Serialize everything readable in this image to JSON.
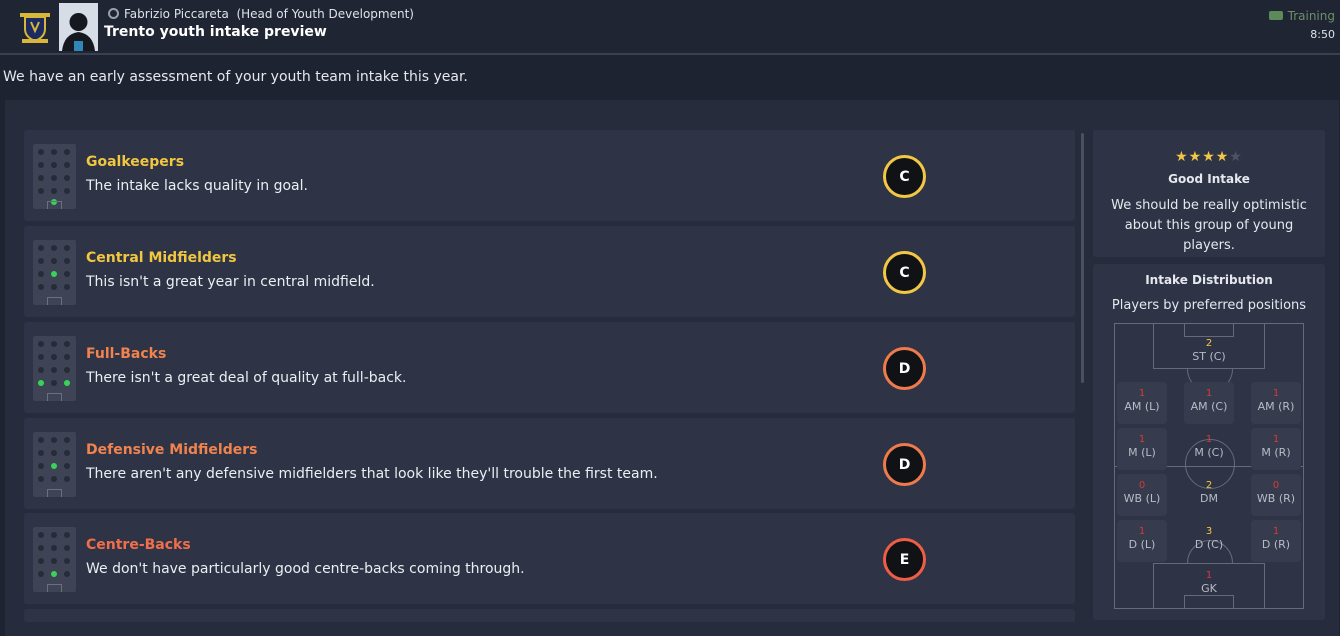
{
  "header": {
    "crest_icon": "club-crest-icon",
    "sender_icon": "person-icon",
    "sender": "Fabrizio Piccareta",
    "sender_role": "(Head of Youth Development)",
    "subject": "Trento youth intake preview",
    "status_icon": "ticket-icon",
    "status": "Training",
    "time": "8:50"
  },
  "intro": "We have an early assessment of your youth team intake this year.",
  "colors": {
    "grade_c": "#f3c744",
    "grade_d": "#ef7b4c",
    "grade_e": "#ef5d45",
    "positive_dot": "#38d45a"
  },
  "rows": [
    {
      "title": "Goalkeepers",
      "description": "The intake lacks quality in goal.",
      "grade": "C"
    },
    {
      "title": "Central Midfielders",
      "description": "This isn't a great year in central midfield.",
      "grade": "C"
    },
    {
      "title": "Full-Backs",
      "description": "There isn't a great deal of quality at full-back.",
      "grade": "D"
    },
    {
      "title": "Defensive Midfielders",
      "description": "There aren't any defensive midfielders that look like they'll trouble the first team.",
      "grade": "D"
    },
    {
      "title": "Centre-Backs",
      "description": "We don't have particularly good centre-backs coming through.",
      "grade": "E"
    }
  ],
  "rating": {
    "stars": 4,
    "max_stars": 5,
    "title": "Good Intake",
    "description": "We should be really optimistic about this group of young players."
  },
  "distribution": {
    "title": "Intake Distribution",
    "subtitle": "Players by preferred positions",
    "positions": {
      "st_c": {
        "label": "ST (C)",
        "count": "2"
      },
      "am_l": {
        "label": "AM (L)",
        "count": "1"
      },
      "am_c": {
        "label": "AM (C)",
        "count": "1"
      },
      "am_r": {
        "label": "AM (R)",
        "count": "1"
      },
      "m_l": {
        "label": "M (L)",
        "count": "1"
      },
      "m_c": {
        "label": "M (C)",
        "count": "1"
      },
      "m_r": {
        "label": "M (R)",
        "count": "1"
      },
      "wb_l": {
        "label": "WB (L)",
        "count": "0"
      },
      "dm": {
        "label": "DM",
        "count": "2"
      },
      "wb_r": {
        "label": "WB (R)",
        "count": "0"
      },
      "d_l": {
        "label": "D (L)",
        "count": "1"
      },
      "d_c": {
        "label": "D (C)",
        "count": "3"
      },
      "d_r": {
        "label": "D (R)",
        "count": "1"
      },
      "gk": {
        "label": "GK",
        "count": "1"
      }
    }
  }
}
